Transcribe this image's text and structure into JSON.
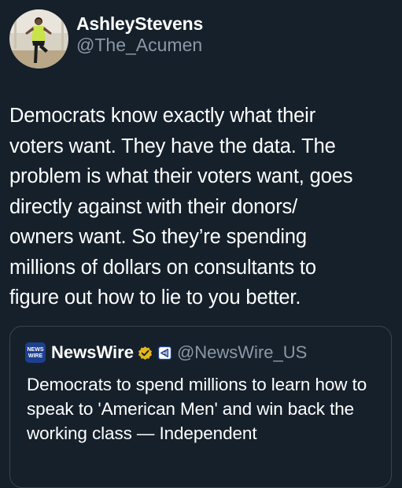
{
  "author": {
    "display_name": "AshleyStevens",
    "handle": "@The_Acumen"
  },
  "tweet": {
    "text": "Democrats know exactly what their\nvoters want. They have the data. The\nproblem is what their voters want, goes\ndirectly against with their donors/\nowners want. So they’re spending\nmillions of dollars on consultants to\nfigure out how to lie to you better."
  },
  "quote": {
    "source_logo_text_line1": "NEWS",
    "source_logo_text_line2": "WIRE",
    "source_name": "NewsWire",
    "source_handle": "@NewsWire_US",
    "text": "Democrats to spend millions to learn how to speak to 'American Men' and win back the working class — Independent",
    "verified_badge_color": "#e2b719"
  },
  "theme": {
    "background": "#15202b",
    "secondary_text": "#8b98a5",
    "border": "#38444d"
  }
}
